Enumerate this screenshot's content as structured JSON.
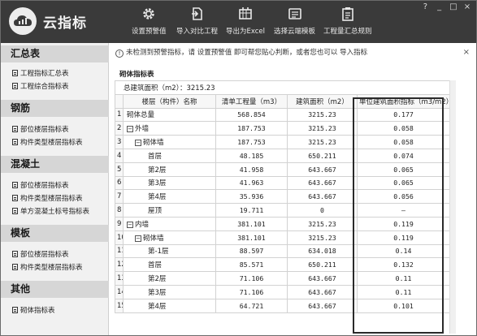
{
  "app": {
    "title": "云指标",
    "toolbar": [
      {
        "label": "设置预警值",
        "icon": "gear-icon"
      },
      {
        "label": "导入对比工程",
        "icon": "import-compare-icon"
      },
      {
        "label": "导出为Excel",
        "icon": "excel-icon"
      },
      {
        "label": "选择云端模板",
        "icon": "cloud-template-icon"
      },
      {
        "label": "工程量汇总规则",
        "icon": "clipboard-icon"
      }
    ],
    "window_controls": [
      "?",
      "_",
      "□",
      "×"
    ]
  },
  "sidebar": {
    "sections": [
      {
        "title": "汇总表",
        "items": [
          "工程指标汇总表",
          "工程综合指标表"
        ]
      },
      {
        "title": "钢筋",
        "items": [
          "部位楼层指标表",
          "构件类型楼层指标表"
        ]
      },
      {
        "title": "混凝土",
        "items": [
          "部位楼层指标表",
          "构件类型楼层指标表",
          "单方混凝土标号指标表"
        ]
      },
      {
        "title": "模板",
        "items": [
          "部位楼层指标表",
          "构件类型楼层指标表"
        ]
      },
      {
        "title": "其他",
        "items": [
          "砌体指标表"
        ]
      }
    ]
  },
  "notice": {
    "text": "未检测到预警指标，请  设置预警值  即可帮您贴心判断，或者您也可以  导入指标",
    "close": "×"
  },
  "panel": {
    "title": "砌体指标表",
    "summary": "总建筑面积（m2）：3215.23",
    "columns": [
      "楼层（构件）名称",
      "清单工程量（m3）",
      "建筑面积（m2）",
      "单位建筑面积指标（m3/m2）"
    ],
    "rows": [
      {
        "n": "1",
        "name": "砌体总量",
        "level": 0,
        "toggle": "",
        "qty": "568.854",
        "area": "3215.23",
        "index": "0.177"
      },
      {
        "n": "2",
        "name": "外墙",
        "level": 0,
        "toggle": "−",
        "qty": "187.753",
        "area": "3215.23",
        "index": "0.058"
      },
      {
        "n": "3",
        "name": "砌体墙",
        "level": 1,
        "toggle": "−",
        "qty": "187.753",
        "area": "3215.23",
        "index": "0.058"
      },
      {
        "n": "4",
        "name": "首层",
        "level": 2,
        "toggle": "",
        "qty": "48.185",
        "area": "650.211",
        "index": "0.074"
      },
      {
        "n": "5",
        "name": "第2层",
        "level": 2,
        "toggle": "",
        "qty": "41.958",
        "area": "643.667",
        "index": "0.065"
      },
      {
        "n": "6",
        "name": "第3层",
        "level": 2,
        "toggle": "",
        "qty": "41.963",
        "area": "643.667",
        "index": "0.065"
      },
      {
        "n": "7",
        "name": "第4层",
        "level": 2,
        "toggle": "",
        "qty": "35.936",
        "area": "643.667",
        "index": "0.056"
      },
      {
        "n": "8",
        "name": "屋顶",
        "level": 2,
        "toggle": "",
        "qty": "19.711",
        "area": "0",
        "index": "–"
      },
      {
        "n": "9",
        "name": "内墙",
        "level": 0,
        "toggle": "−",
        "qty": "381.101",
        "area": "3215.23",
        "index": "0.119"
      },
      {
        "n": "10",
        "name": "砌体墙",
        "level": 1,
        "toggle": "−",
        "qty": "381.101",
        "area": "3215.23",
        "index": "0.119"
      },
      {
        "n": "11",
        "name": "第-1层",
        "level": 2,
        "toggle": "",
        "qty": "88.597",
        "area": "634.018",
        "index": "0.14"
      },
      {
        "n": "12",
        "name": "首层",
        "level": 2,
        "toggle": "",
        "qty": "85.571",
        "area": "650.211",
        "index": "0.132"
      },
      {
        "n": "13",
        "name": "第2层",
        "level": 2,
        "toggle": "",
        "qty": "71.106",
        "area": "643.667",
        "index": "0.11"
      },
      {
        "n": "14",
        "name": "第3层",
        "level": 2,
        "toggle": "",
        "qty": "71.106",
        "area": "643.667",
        "index": "0.11"
      },
      {
        "n": "15",
        "name": "第4层",
        "level": 2,
        "toggle": "",
        "qty": "64.721",
        "area": "643.667",
        "index": "0.101"
      }
    ]
  }
}
